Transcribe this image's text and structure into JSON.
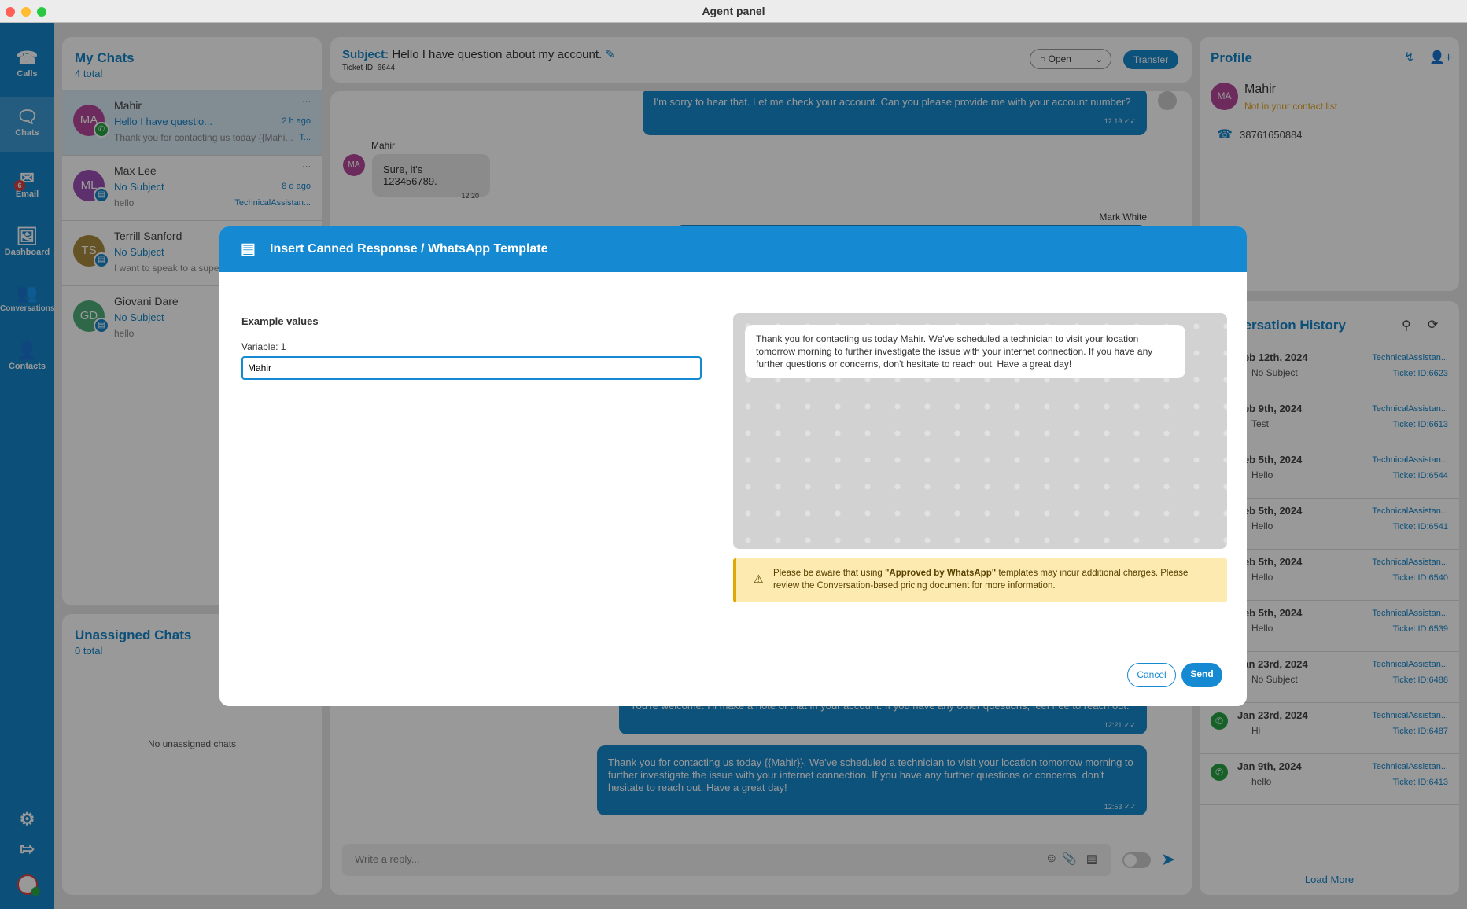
{
  "window": {
    "title": "Agent panel"
  },
  "sidebar": {
    "items": [
      {
        "label": "Calls",
        "icon": "phone-icon"
      },
      {
        "label": "Chats",
        "icon": "chat-icon",
        "active": true
      },
      {
        "label": "Email",
        "icon": "email-icon",
        "badge": "6"
      },
      {
        "label": "Dashboard",
        "icon": "dashboard-icon"
      },
      {
        "label": "Conversations",
        "icon": "people-icon"
      },
      {
        "label": "Contacts",
        "icon": "contacts-icon"
      }
    ],
    "bottom": [
      "gear-icon",
      "logout-icon",
      "user-avatar-icon"
    ]
  },
  "my_chats": {
    "title": "My Chats",
    "total": "4 total",
    "items": [
      {
        "initials": "MA",
        "name": "Mahir",
        "subject": "Hello I have questio...",
        "time": "2 h ago",
        "preview": "Thank you for contacting us today {{Mahi...",
        "meta": "T...",
        "color": "#b5499a",
        "channel": "whatsapp"
      },
      {
        "initials": "ML",
        "name": "Max Lee",
        "subject": "No Subject",
        "time": "8 d ago",
        "preview": "hello",
        "meta": "TechnicalAssistan...",
        "color": "#9b4fb5",
        "channel": "chat"
      },
      {
        "initials": "TS",
        "name": "Terrill Sanford",
        "subject": "No Subject",
        "time": "",
        "preview": "I want to speak to a supe",
        "meta": "",
        "color": "#a88a3e",
        "channel": "chat"
      },
      {
        "initials": "GD",
        "name": "Giovani Dare",
        "subject": "No Subject",
        "time": "",
        "preview": "hello",
        "meta": "",
        "color": "#4fae78",
        "channel": "chat"
      }
    ]
  },
  "unassigned": {
    "title": "Unassigned Chats",
    "total": "0 total",
    "empty": "No unassigned chats"
  },
  "chat": {
    "subject_label": "Subject:",
    "subject": "Hello I have question about my account.",
    "ticket": "Ticket ID: 6644",
    "status": "Open",
    "transfer": "Transfer",
    "messages": [
      {
        "text": "I'm sorry to hear that. Let me check your account. Can you please provide me with your account number?",
        "time": "12:19",
        "dir": "out"
      },
      {
        "sender": "Mahir",
        "initials": "MA",
        "text": "Sure, it's 123456789.",
        "time": "12:20",
        "dir": "in"
      },
      {
        "sender": "Mark White",
        "dir": "out"
      },
      {
        "text": "You're welcome. I'll make a note of that in your account. If you have any other questions, feel free to reach out.",
        "time": "12:21",
        "dir": "out"
      },
      {
        "text": "Thank you for contacting us today {{Mahir}}. We've scheduled a technician to visit your location tomorrow morning to further investigate the issue with your internet connection. If you have any further questions or concerns, don't hesitate to reach out. Have a great day!",
        "time": "12:53",
        "dir": "out"
      }
    ],
    "reply_placeholder": "Write a reply..."
  },
  "profile": {
    "title": "Profile",
    "initials": "MA",
    "name": "Mahir",
    "note": "Not in your contact list",
    "phone": "38761650884"
  },
  "history": {
    "title": "Conversation History",
    "load_more": "Load More",
    "items": [
      {
        "date": "Feb 12th, 2024",
        "subject": "No Subject",
        "agent": "TechnicalAssistan...",
        "ticket": "Ticket ID:6623"
      },
      {
        "date": "Feb 9th, 2024",
        "subject": "Test",
        "agent": "TechnicalAssistan...",
        "ticket": "Ticket ID:6613"
      },
      {
        "date": "Feb 5th, 2024",
        "subject": "Hello",
        "agent": "TechnicalAssistan...",
        "ticket": "Ticket ID:6544"
      },
      {
        "date": "Feb 5th, 2024",
        "subject": "Hello",
        "agent": "TechnicalAssistan...",
        "ticket": "Ticket ID:6541"
      },
      {
        "date": "Feb 5th, 2024",
        "subject": "Hello",
        "agent": "TechnicalAssistan...",
        "ticket": "Ticket ID:6540"
      },
      {
        "date": "Feb 5th, 2024",
        "subject": "Hello",
        "agent": "TechnicalAssistan...",
        "ticket": "Ticket ID:6539"
      },
      {
        "date": "Jan 23rd, 2024",
        "subject": "No Subject",
        "agent": "TechnicalAssistan...",
        "ticket": "Ticket ID:6488"
      },
      {
        "date": "Jan 23rd, 2024",
        "subject": "Hi",
        "agent": "TechnicalAssistan...",
        "ticket": "Ticket ID:6487"
      },
      {
        "date": "Jan 9th, 2024",
        "subject": "hello",
        "agent": "TechnicalAssistan...",
        "ticket": "Ticket ID:6413"
      }
    ]
  },
  "modal": {
    "title": "Insert Canned Response / WhatsApp Template",
    "section": "Example values",
    "variable_label": "Variable: 1",
    "variable_value": "Mahir",
    "preview": "Thank you for contacting us today Mahir. We've scheduled a technician to visit your location tomorrow morning to further investigate the issue with your internet connection. If you have any further questions or concerns, don't hesitate to reach out. Have a great day!",
    "warning_pre": "Please be aware that using ",
    "warning_bold": "\"Approved by WhatsApp\"",
    "warning_post": " templates may incur additional charges. Please review the Conversation-based pricing document for more information.",
    "cancel": "Cancel",
    "send": "Send"
  },
  "colors": {
    "accent": "#1589d1",
    "sidebar": "#1585ca",
    "warning_bg": "#fdeab0",
    "warning_border": "#e0a800",
    "whatsapp": "#25a244"
  }
}
